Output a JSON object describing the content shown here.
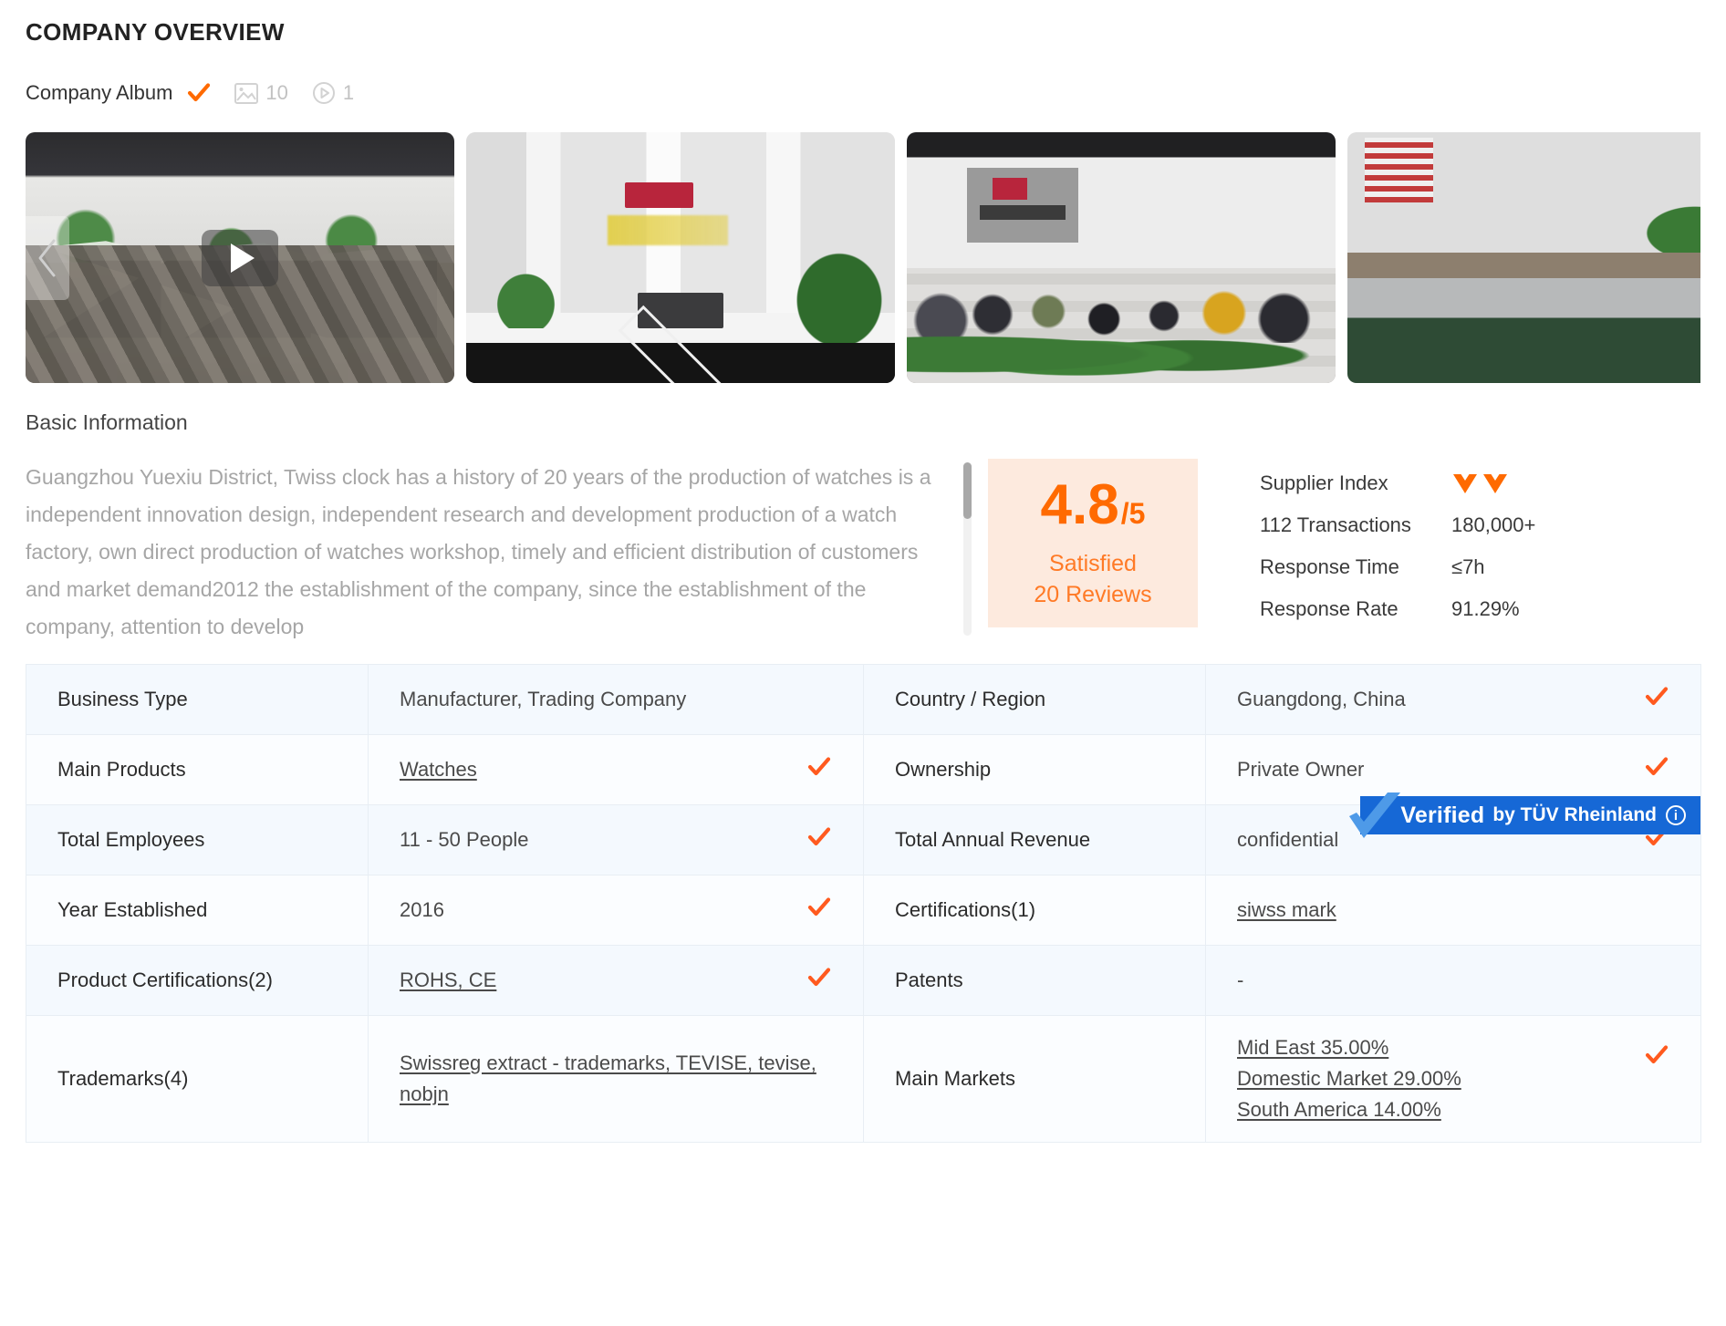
{
  "section": {
    "title": "COMPANY OVERVIEW"
  },
  "album": {
    "label": "Company Album",
    "verified_icon": "orange-check-icon",
    "photo_icon": "image-icon",
    "photo_count": "10",
    "video_icon": "play-circle-icon",
    "video_count": "1"
  },
  "gallery": {
    "prev_icon": "chevron-left-icon",
    "next_icon": "chevron-right-icon",
    "play_icon": "play-triangle-icon",
    "items": [
      {
        "name": "showroom-video-thumbnail",
        "has_video": true
      },
      {
        "name": "reception-lobby-photo",
        "has_video": false
      },
      {
        "name": "open-office-photo",
        "has_video": false
      },
      {
        "name": "workshop-photo-partial",
        "has_video": false
      }
    ]
  },
  "basic": {
    "heading": "Basic Information",
    "description": "Guangzhou Yuexiu District, Twiss clock has a history of 20 years of the production of watches is a independent innovation design, independent research and development production of a watch factory, own direct production of watches workshop, timely and efficient distribution of customers and market demand2012 the establishment of the company, since the establishment of the company, attention to develop"
  },
  "score": {
    "value": "4.8",
    "denominator": "/5",
    "label": "Satisfied",
    "reviews": "20 Reviews"
  },
  "metrics": [
    {
      "key": "Supplier Index",
      "value": "",
      "icon": "diamond-heart-icon",
      "icon_count": 2
    },
    {
      "key": "112 Transactions",
      "value": "180,000+",
      "icon": "",
      "icon_count": 0
    },
    {
      "key": "Response Time",
      "value": "≤7h",
      "icon": "",
      "icon_count": 0
    },
    {
      "key": "Response Rate",
      "value": "91.29%",
      "icon": "",
      "icon_count": 0
    }
  ],
  "verified": {
    "strong": "Verified",
    "by": "by TÜV Rheinland",
    "info_icon": "info-circle-icon",
    "tick_icon": "blue-check-icon",
    "color": "#1668d6"
  },
  "table": {
    "rows": [
      {
        "left_key": "Business Type",
        "left_value": "Manufacturer, Trading Company",
        "left_link": false,
        "left_check": false,
        "right_key": "Country / Region",
        "right_value": "Guangdong, China",
        "right_link": false,
        "right_check": true
      },
      {
        "left_key": "Main Products",
        "left_value": "Watches",
        "left_link": true,
        "left_check": true,
        "right_key": "Ownership",
        "right_value": "Private Owner",
        "right_link": false,
        "right_check": true
      },
      {
        "left_key": "Total Employees",
        "left_value": "11 - 50 People",
        "left_link": false,
        "left_check": true,
        "right_key": "Total Annual Revenue",
        "right_value": "confidential",
        "right_link": false,
        "right_check": true
      },
      {
        "left_key": "Year Established",
        "left_value": "2016",
        "left_link": false,
        "left_check": true,
        "right_key": "Certifications(1)",
        "right_value": "siwss mark",
        "right_link": true,
        "right_check": false
      },
      {
        "left_key": "Product Certifications(2)",
        "left_value": "ROHS, CE",
        "left_link": true,
        "left_check": true,
        "right_key": "Patents",
        "right_value": "-",
        "right_link": false,
        "right_check": false
      },
      {
        "left_key": "Trademarks(4)",
        "left_value": "Swissreg extract - trademarks, TEVISE, tevise, nobjn",
        "left_link": true,
        "left_check": false,
        "right_key": "Main Markets",
        "right_value": "Mid East 35.00%\nDomestic Market 29.00%\nSouth America 14.00%",
        "right_link": true,
        "right_check": true
      }
    ]
  },
  "colors": {
    "accent_orange": "#ff6a00",
    "verified_blue": "#1668d6",
    "table_row_bg": "#f4f9fe",
    "score_card_bg": "#fdeade"
  }
}
